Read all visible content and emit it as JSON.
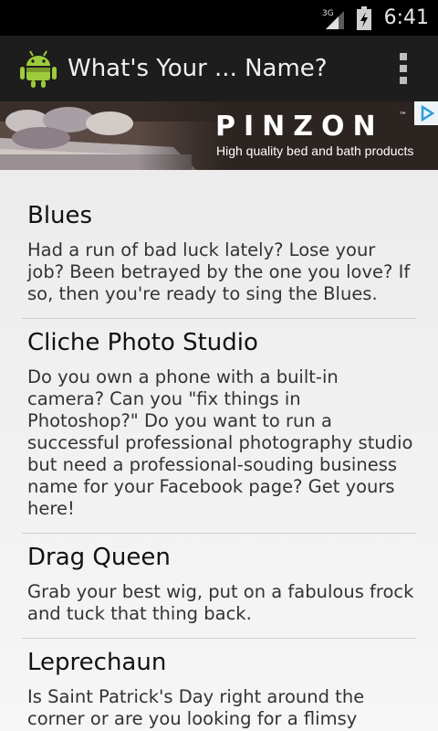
{
  "status_bar": {
    "network": "3G",
    "time": "6:41"
  },
  "action_bar": {
    "title": "What's Your ... Name?",
    "icon": "android-app-icon",
    "menu_icon": "overflow-menu-icon"
  },
  "ad": {
    "brand": "PINZON",
    "trademark": "™",
    "tagline": "High quality bed and bath products",
    "choices_icon": "adchoices-icon"
  },
  "items": [
    {
      "title": "Blues",
      "description": "Had a run of bad luck lately? Lose your job? Been betrayed by the one you love? If so, then you're ready to sing the Blues."
    },
    {
      "title": "Cliche Photo Studio",
      "description": "Do you own a phone with a built-in camera? Can you \"fix things in Photoshop?\" Do you want to run a successful professional photography studio but need a professional-souding business name for your Facebook page? Get yours here!"
    },
    {
      "title": "Drag Queen",
      "description": "Grab your best wig, put on a fabulous frock and tuck that thing back."
    },
    {
      "title": "Leprechaun",
      "description": "Is Saint Patrick's Day right around the corner or are you looking for a flimsy excuse to"
    }
  ]
}
